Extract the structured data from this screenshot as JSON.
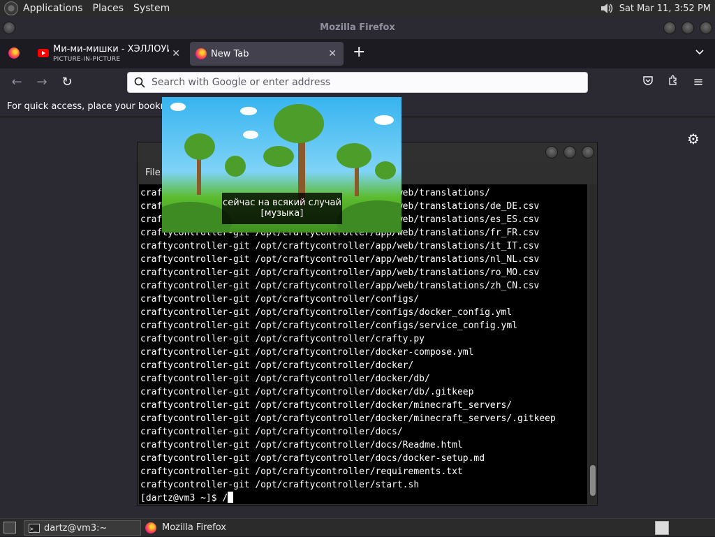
{
  "top_panel": {
    "menus": [
      "Applications",
      "Places",
      "System"
    ],
    "clock": "Sat Mar 11,  3:52 PM"
  },
  "firefox": {
    "window_title": "Mozilla Firefox",
    "tabs": [
      {
        "title": "Ми-ми-мишки - ХЭЛЛОУИН",
        "subtitle": "PICTURE-IN-PICTURE",
        "icon": "youtube-icon"
      },
      {
        "title": "New Tab",
        "icon": "firefox-icon"
      }
    ],
    "urlbar_placeholder": "Search with Google or enter address",
    "bookmarks_hint": "For quick access, place your bookmarks here on the bookmarks toolbar."
  },
  "pip": {
    "subtitle_line1": "сейчас на всякий случай",
    "subtitle_line2": "[музыка]"
  },
  "terminal": {
    "menu_file": "File",
    "lines": [
      "craftycontroller-git /opt/craftycontroller/app/web/translations/",
      "craftycontroller-git /opt/craftycontroller/app/web/translations/de_DE.csv",
      "craftycontroller-git /opt/craftycontroller/app/web/translations/es_ES.csv",
      "craftycontroller-git /opt/craftycontroller/app/web/translations/fr_FR.csv",
      "craftycontroller-git /opt/craftycontroller/app/web/translations/it_IT.csv",
      "craftycontroller-git /opt/craftycontroller/app/web/translations/nl_NL.csv",
      "craftycontroller-git /opt/craftycontroller/app/web/translations/ro_MO.csv",
      "craftycontroller-git /opt/craftycontroller/app/web/translations/zh_CN.csv",
      "craftycontroller-git /opt/craftycontroller/configs/",
      "craftycontroller-git /opt/craftycontroller/configs/docker_config.yml",
      "craftycontroller-git /opt/craftycontroller/configs/service_config.yml",
      "craftycontroller-git /opt/craftycontroller/crafty.py",
      "craftycontroller-git /opt/craftycontroller/docker-compose.yml",
      "craftycontroller-git /opt/craftycontroller/docker/",
      "craftycontroller-git /opt/craftycontroller/docker/db/",
      "craftycontroller-git /opt/craftycontroller/docker/db/.gitkeep",
      "craftycontroller-git /opt/craftycontroller/docker/minecraft_servers/",
      "craftycontroller-git /opt/craftycontroller/docker/minecraft_servers/.gitkeep",
      "craftycontroller-git /opt/craftycontroller/docs/",
      "craftycontroller-git /opt/craftycontroller/docs/Readme.html",
      "craftycontroller-git /opt/craftycontroller/docs/docker-setup.md",
      "craftycontroller-git /opt/craftycontroller/requirements.txt",
      "craftycontroller-git /opt/craftycontroller/start.sh"
    ],
    "prompt": "[dartz@vm3 ~]$ /"
  },
  "taskbar": {
    "items": [
      {
        "label": "dartz@vm3:~",
        "icon": "terminal-icon"
      },
      {
        "label": "Mozilla Firefox",
        "icon": "firefox-icon"
      }
    ]
  },
  "colors": {
    "firefox_dark": "#2b2a33",
    "terminal_bg": "#000000",
    "panel_bg": "#2b2b2b"
  }
}
